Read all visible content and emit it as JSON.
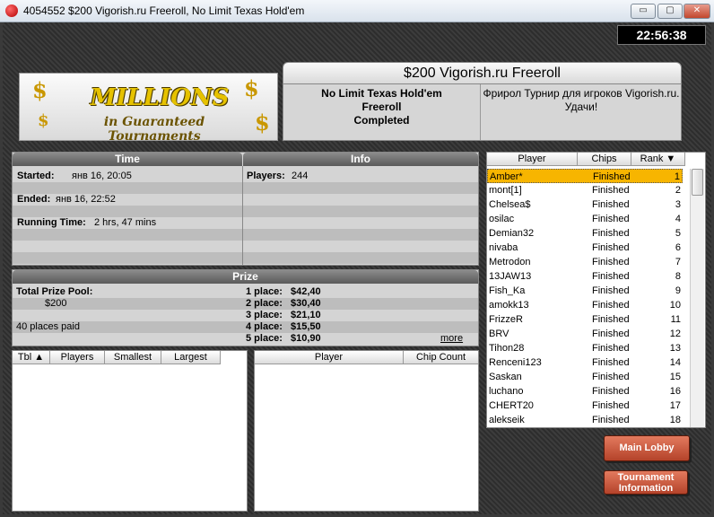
{
  "window": {
    "title": "4054552 $200 Vigorish.ru Freeroll, No Limit Texas Hold'em",
    "minimize": "▭",
    "maximize": "▢",
    "close": "✕"
  },
  "clock": "22:56:38",
  "banner": {
    "logo_line1": "MILLIONS",
    "logo_line2": "in Guaranteed Tournaments"
  },
  "tournament": {
    "name": "$200 Vigorish.ru Freeroll",
    "game_line1": "No Limit Texas Hold'em",
    "game_line2": "Freeroll",
    "status": "Completed",
    "description": "Фрирол Турнир для игроков Vigorish.ru. Удачи!"
  },
  "time_panel": {
    "header_time": "Time",
    "header_info": "Info",
    "started_label": "Started:",
    "started_value": "янв 16, 20:05",
    "ended_label": "Ended:",
    "ended_value": "янв 16, 22:52",
    "running_label": "Running Time:",
    "running_value": "2 hrs, 47 mins",
    "players_label": "Players:",
    "players_value": "244"
  },
  "prize_panel": {
    "header": "Prize",
    "pool_label": "Total Prize Pool:",
    "pool_value": "$200",
    "places_paid": "40 places paid",
    "more": "more",
    "places": [
      {
        "label": "1 place:",
        "amount": "$42,40"
      },
      {
        "label": "2 place:",
        "amount": "$30,40"
      },
      {
        "label": "3 place:",
        "amount": "$21,10"
      },
      {
        "label": "4 place:",
        "amount": "$15,50"
      },
      {
        "label": "5 place:",
        "amount": "$10,90"
      }
    ]
  },
  "tables_list": {
    "col_tbl": "Tbl",
    "col_players": "Players",
    "col_smallest": "Smallest",
    "col_largest": "Largest"
  },
  "table_players": {
    "col_player": "Player",
    "col_chips": "Chip Count"
  },
  "players": {
    "col_player": "Player",
    "col_chips": "Chips",
    "col_rank": "Rank",
    "rows": [
      {
        "name": "Amber*",
        "chips": "Finished",
        "rank": "1"
      },
      {
        "name": "mont[1]",
        "chips": "Finished",
        "rank": "2"
      },
      {
        "name": "Chelsea$",
        "chips": "Finished",
        "rank": "3"
      },
      {
        "name": "osilac",
        "chips": "Finished",
        "rank": "4"
      },
      {
        "name": "Demian32",
        "chips": "Finished",
        "rank": "5"
      },
      {
        "name": "nivaba",
        "chips": "Finished",
        "rank": "6"
      },
      {
        "name": "Metrodon",
        "chips": "Finished",
        "rank": "7"
      },
      {
        "name": "13JAW13",
        "chips": "Finished",
        "rank": "8"
      },
      {
        "name": "Fish_Ka",
        "chips": "Finished",
        "rank": "9"
      },
      {
        "name": "amokk13",
        "chips": "Finished",
        "rank": "10"
      },
      {
        "name": "FrizzeR",
        "chips": "Finished",
        "rank": "11"
      },
      {
        "name": "BRV",
        "chips": "Finished",
        "rank": "12"
      },
      {
        "name": "Tihon28",
        "chips": "Finished",
        "rank": "13"
      },
      {
        "name": "Renceni123",
        "chips": "Finished",
        "rank": "14"
      },
      {
        "name": "Saskan",
        "chips": "Finished",
        "rank": "15"
      },
      {
        "name": "luchano",
        "chips": "Finished",
        "rank": "16"
      },
      {
        "name": "CHERT20",
        "chips": "Finished",
        "rank": "17"
      },
      {
        "name": "alekseik",
        "chips": "Finished",
        "rank": "18"
      }
    ]
  },
  "buttons": {
    "main_lobby": "Main Lobby",
    "tourn_info_1": "Tournament",
    "tourn_info_2": "Information"
  }
}
